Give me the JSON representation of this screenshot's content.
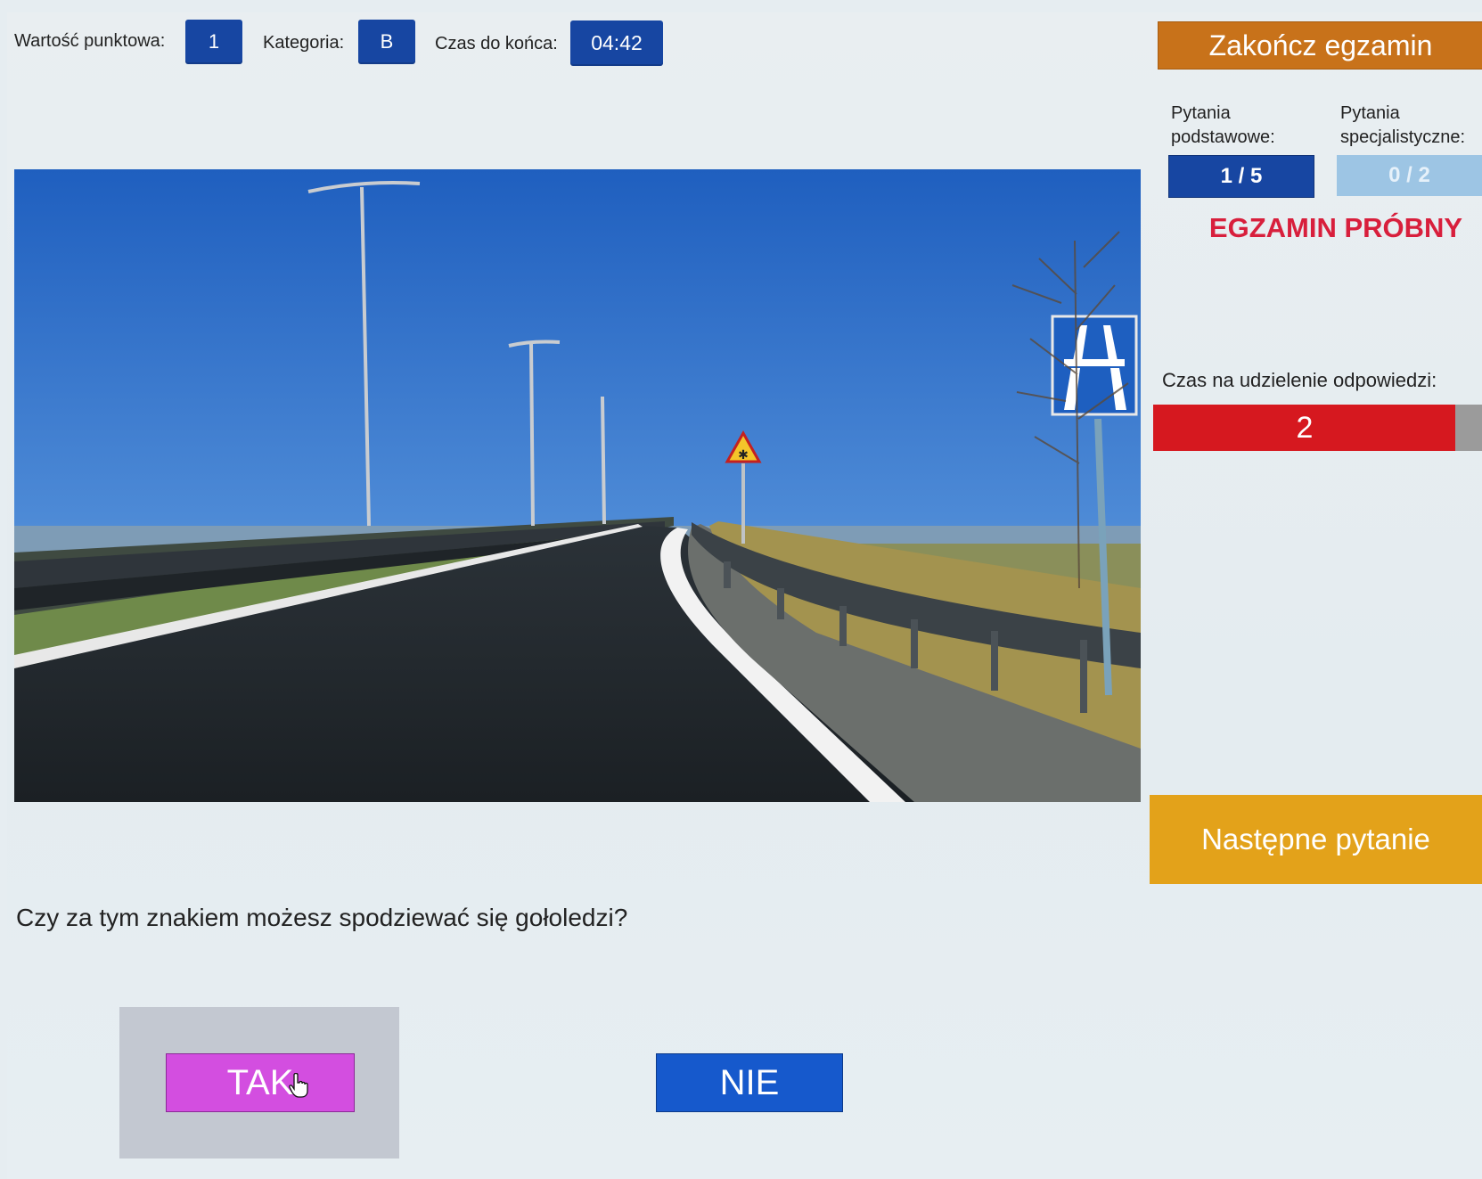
{
  "header": {
    "points_label": "Wartość punktowa:",
    "points_value": "1",
    "category_label": "Kategoria:",
    "category_value": "B",
    "time_left_label": "Czas do końca:",
    "time_left_value": "04:42",
    "end_exam_label": "Zakończ egzamin"
  },
  "sidebar": {
    "basic_label": "Pytania podstawowe:",
    "basic_value": "1 / 5",
    "specialist_label": "Pytania specjalistyczne:",
    "specialist_value": "0 / 2",
    "trial_label": "EGZAMIN PRÓBNY",
    "answer_time_label": "Czas na udzielenie odpowiedzi:",
    "answer_time_value": "2",
    "next_label": "Następne pytanie"
  },
  "question": {
    "text": "Czy za tym znakiem możesz spodziewać się gołoledzi?",
    "yes_label": "TAK",
    "no_label": "NIE",
    "selected": "TAK"
  },
  "colors": {
    "pill_blue": "#1746a2",
    "end_orange": "#c8721a",
    "next_yellow": "#e3a21a",
    "trial_red": "#d81f3c",
    "timer_red": "#d6181f",
    "tak_magenta": "#d34ee0",
    "nie_blue": "#1659cc"
  }
}
